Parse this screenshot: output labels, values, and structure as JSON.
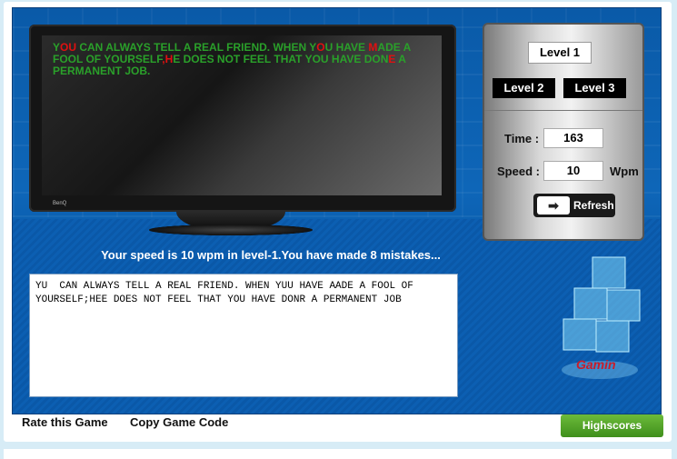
{
  "target_text": {
    "segments": [
      {
        "t": "Y",
        "err": false
      },
      {
        "t": "OU",
        "err": true
      },
      {
        "t": " CAN ALWAYS TELL A REAL FRIEND. WHEN Y",
        "err": false
      },
      {
        "t": "O",
        "err": true
      },
      {
        "t": "U HAVE ",
        "err": false
      },
      {
        "t": "M",
        "err": true
      },
      {
        "t": "ADE A FOOL OF YOURSELF",
        "err": false
      },
      {
        "t": ",H",
        "err": true
      },
      {
        "t": "E DOES NOT FEEL THAT YOU HAVE DON",
        "err": false
      },
      {
        "t": "E",
        "err": true
      },
      {
        "t": " A PERMANENT JOB.",
        "err": false
      }
    ]
  },
  "monitor": {
    "brand": "BenQ"
  },
  "levels": {
    "level1": "Level 1",
    "level2": "Level 2",
    "level3": "Level 3"
  },
  "stats": {
    "time_label": "Time :",
    "time_value": "163",
    "speed_label": "Speed :",
    "speed_value": "10",
    "speed_unit": "Wpm"
  },
  "refresh_label": "Refresh",
  "status_message": "Your speed is 10 wpm in level-1.You have made 8 mistakes...",
  "typed_text": "YU  CAN ALWAYS TELL A REAL FRIEND. WHEN YUU HAVE AADE A FOOL OF YOURSELF;HEE DOES NOT FEEL THAT YOU HAVE DONR A PERMANENT JOB",
  "logo_text": "Gamin",
  "footer": {
    "rate": "Rate this Game",
    "copy": "Copy Game Code",
    "highscores": "Highscores"
  },
  "colors": {
    "correct": "#2aa02a",
    "mistake": "#e01010",
    "background": "#0b5fb0",
    "highscores": "#4a9a24"
  }
}
